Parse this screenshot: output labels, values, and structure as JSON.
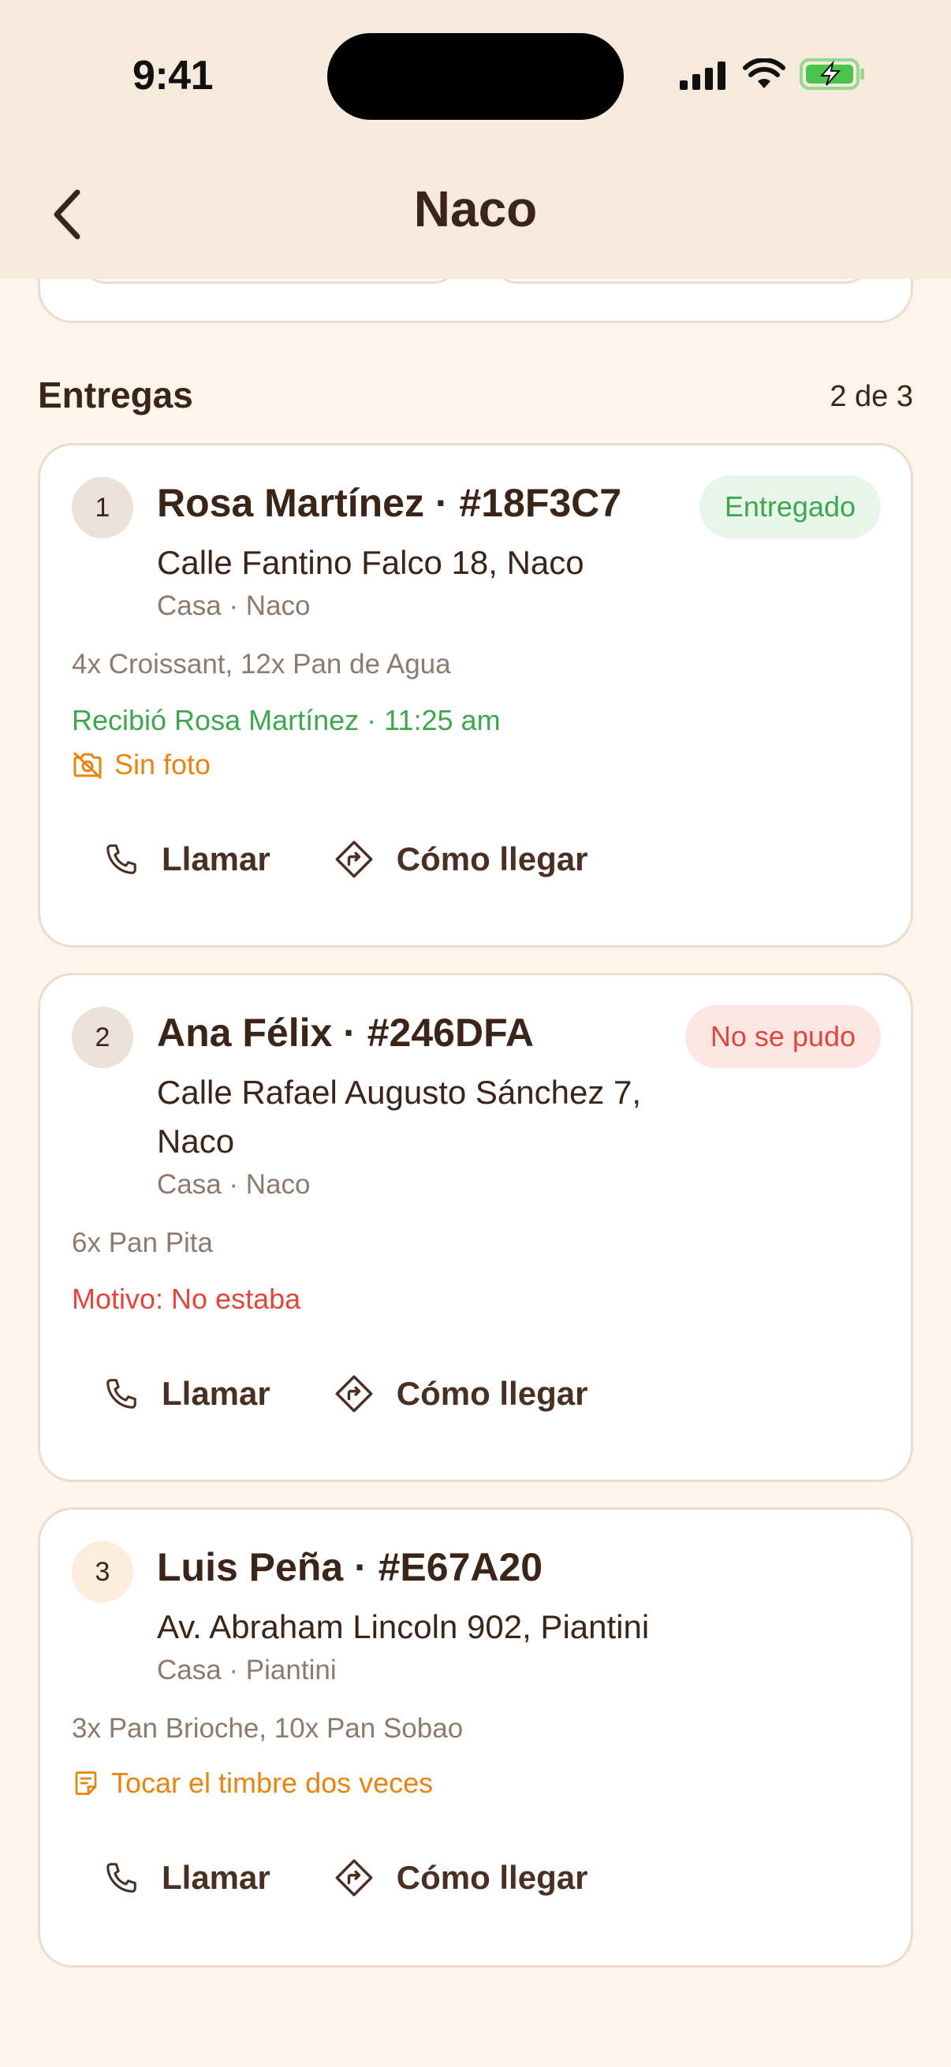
{
  "status_bar": {
    "time": "9:41"
  },
  "header": {
    "title": "Naco"
  },
  "section": {
    "title": "Entregas",
    "count": "2 de 3"
  },
  "deliveries": [
    {
      "number": "1",
      "name": "Rosa Martínez · #18F3C7",
      "status": "Entregado",
      "address": "Calle Fantino Falco 18, Naco",
      "sub": "Casa · Naco",
      "items": "4x Croissant, 12x Pan de Agua",
      "received": "Recibió Rosa Martínez · 11:25 am",
      "photo_note": "Sin foto",
      "call_label": "Llamar",
      "directions_label": "Cómo llegar"
    },
    {
      "number": "2",
      "name": "Ana Félix · #246DFA",
      "status": "No se pudo",
      "address_line1": "Calle Rafael Augusto Sánchez 7,",
      "address_line2": "Naco",
      "sub": "Casa · Naco",
      "items": "6x Pan Pita",
      "reason": "Motivo: No estaba",
      "call_label": "Llamar",
      "directions_label": "Cómo llegar"
    },
    {
      "number": "3",
      "name": "Luis Peña · #E67A20",
      "address": "Av. Abraham Lincoln 902, Piantini",
      "sub": "Casa · Piantini",
      "items": "3x Pan Brioche, 10x Pan Sobao",
      "instructions": "Tocar el timbre dos veces",
      "call_label": "Llamar",
      "directions_label": "Cómo llegar"
    }
  ],
  "colors": {
    "background": "#FDF5EC",
    "header": "#F5EADC",
    "text": "#3B2418",
    "muted": "#8C7A6E",
    "success": "#3FA64F",
    "error": "#E0463C",
    "warning": "#E8830F"
  },
  "icons": [
    "chevron-left-icon",
    "signal-icon",
    "wifi-icon",
    "battery-charging-icon",
    "camera-off-icon",
    "phone-icon",
    "directions-icon",
    "note-icon"
  ]
}
